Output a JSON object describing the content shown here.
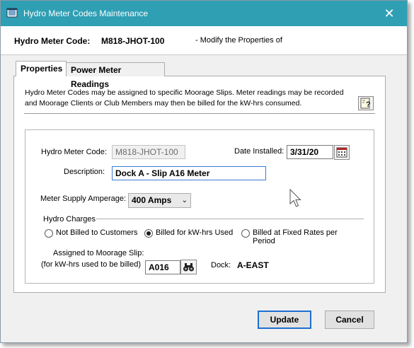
{
  "window": {
    "title": "Hydro Meter Codes Maintenance",
    "close_glyph": "✕",
    "titlebar_color": "#2f9fb4"
  },
  "header": {
    "code_label": "Hydro Meter Code:",
    "code_value": "M818-JHOT-100",
    "mode_text": "- Modify the Properties of"
  },
  "tabs": [
    {
      "label": "Properties",
      "active": true
    },
    {
      "label": "Power Meter Readings",
      "active": false
    }
  ],
  "properties": {
    "description_text": "Hydro Meter Codes may be assigned to specific Moorage Slips.  Meter readings may be recorded and Moorage Clients or Club Members may then be billed for the kW-hrs consumed.",
    "help_icon": "help-icon",
    "code_label": "Hydro Meter Code:",
    "code_value": "M818-JHOT-100",
    "date_label": "Date Installed:",
    "date_value": "3/31/20",
    "calendar_icon": "calendar-icon",
    "desc_label": "Description:",
    "desc_value": "Dock A - Slip A16 Meter",
    "amp_label": "Meter Supply Amperage:",
    "amp_value": "400 Amps",
    "hydro_group_label": "Hydro Charges",
    "radios": [
      {
        "label": "Not Billed to Customers",
        "selected": false
      },
      {
        "label": "Billed for kW-hrs Used",
        "selected": true
      },
      {
        "label": "Billed at Fixed Rates per Period",
        "selected": false
      }
    ],
    "slip_label_line1": "Assigned to Moorage Slip:",
    "slip_label_line2": "(for kW-hrs used to be billed)",
    "slip_value": "A016",
    "slip_lookup_icon": "binoculars-icon",
    "dock_label": "Dock:",
    "dock_value": "A-EAST"
  },
  "buttons": {
    "update": "Update",
    "cancel": "Cancel"
  }
}
